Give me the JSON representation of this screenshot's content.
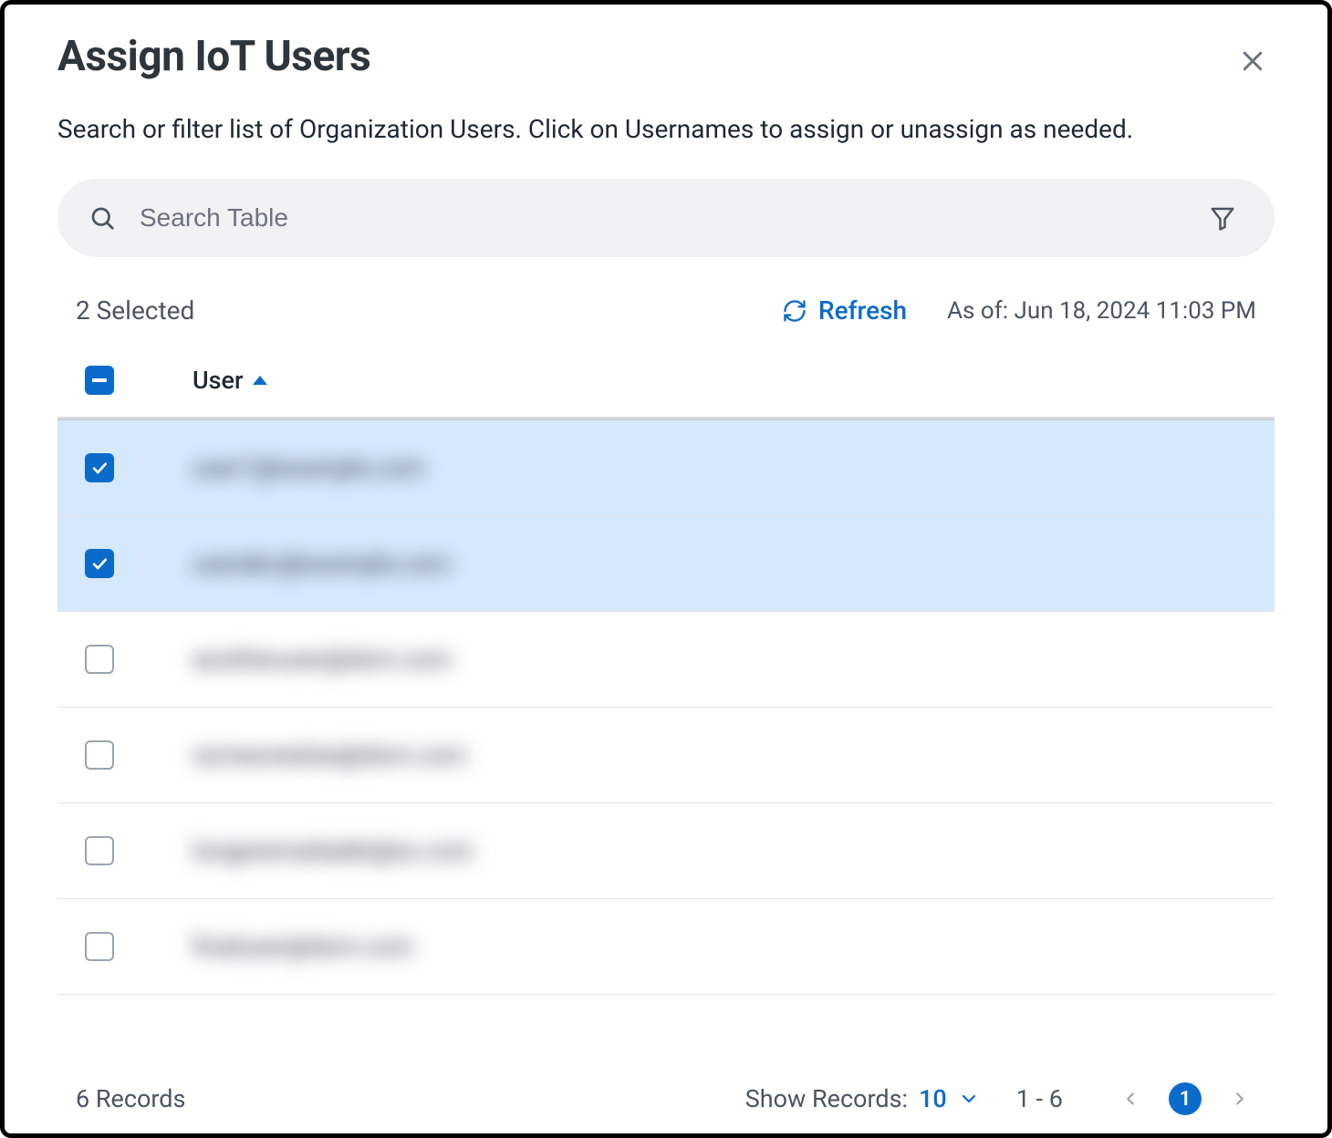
{
  "header": {
    "title": "Assign IoT Users",
    "subtitle": "Search or filter list of Organization Users. Click on Usernames to assign or unassign as needed."
  },
  "search": {
    "placeholder": "Search Table",
    "value": ""
  },
  "status": {
    "selected_count_text": "2 Selected",
    "refresh_label": "Refresh",
    "as_of": "As of: Jun 18, 2024 11:03 PM"
  },
  "table": {
    "header_user": "User",
    "rows": [
      {
        "selected": true,
        "user": "user1@example.com"
      },
      {
        "selected": true,
        "user": "userabc@example.com"
      },
      {
        "selected": false,
        "user": "anotheruser@dom.com"
      },
      {
        "selected": false,
        "user": "someoneelse@dom.com"
      },
      {
        "selected": false,
        "user": "longeremailaddr@ex.com"
      },
      {
        "selected": false,
        "user": "finaluser@dom.com"
      }
    ]
  },
  "footer": {
    "records_text": "6 Records",
    "show_records_label": "Show Records:",
    "show_records_value": "10",
    "range_text": "1 - 6",
    "current_page": "1"
  }
}
